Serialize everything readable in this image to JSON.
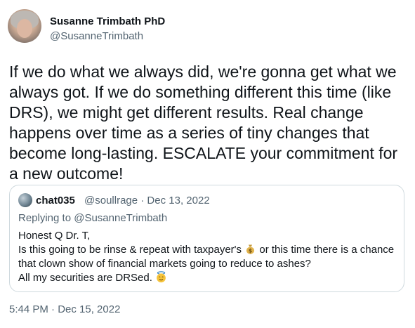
{
  "author": {
    "name": "Susanne Trimbath PhD",
    "handle": "@SusanneTrimbath"
  },
  "tweet": {
    "lines": [
      "If we do what we always did, we're gonna get what we",
      "always got. If we do something different this time (like",
      "DRS), we might get different results. Real change",
      "happens over time as a series of tiny changes that",
      "become long-lasting. ESCALATE your commitment for",
      "a new outcome!"
    ],
    "timestamp": "5:44 PM · Dec 15, 2022"
  },
  "quoted": {
    "name": "chat035",
    "meta": "@soullrage · Dec 13, 2022",
    "replying_to": "Replying to @SusanneTrimbath",
    "line1": "Honest Q Dr. T,",
    "line2_a": "Is this going to be rinse & repeat with taxpayer's ",
    "line2_b": " or this time there is a chance",
    "line3": "that  clown show of financial markets going to reduce to ashes?",
    "line4": "All my securities are DRSed. ",
    "emoji_moneybag": "money-bag-emoji",
    "emoji_halo": "smiling-face-with-halo-emoji"
  }
}
